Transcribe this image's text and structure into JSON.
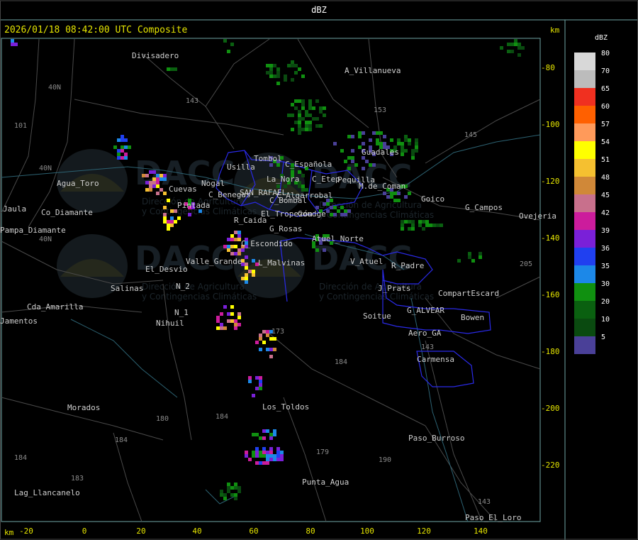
{
  "header": {
    "product": "dBZ",
    "timestamp": "2026/01/18 08:42:00 UTC Composite",
    "unit_top": "km",
    "unit_bottom": "km"
  },
  "axes": {
    "x_ticks": [
      "-20",
      "0",
      "20",
      "40",
      "60",
      "80",
      "100",
      "120",
      "140"
    ],
    "y_ticks": [
      "-80",
      "-100",
      "-120",
      "-140",
      "-160",
      "-180",
      "-200",
      "-220"
    ]
  },
  "legend": {
    "title": "dBZ",
    "levels": [
      {
        "label": "80",
        "color": "#d8d8d8"
      },
      {
        "label": "70",
        "color": "#bcbcbc"
      },
      {
        "label": "65",
        "color": "#f03020"
      },
      {
        "label": "60",
        "color": "#ff6000"
      },
      {
        "label": "57",
        "color": "#ff9a5a"
      },
      {
        "label": "54",
        "color": "#ffff00"
      },
      {
        "label": "51",
        "color": "#f5c030"
      },
      {
        "label": "48",
        "color": "#d08838"
      },
      {
        "label": "45",
        "color": "#c8708c"
      },
      {
        "label": "42",
        "color": "#cc1c9c"
      },
      {
        "label": "39",
        "color": "#7a20d8"
      },
      {
        "label": "36",
        "color": "#2040f0"
      },
      {
        "label": "35",
        "color": "#1c88e8"
      },
      {
        "label": "30",
        "color": "#109010"
      },
      {
        "label": "20",
        "color": "#0a6010"
      },
      {
        "label": "10",
        "color": "#0a4a10"
      },
      {
        "label": "5",
        "color": "#4a4098"
      }
    ]
  },
  "watermark": {
    "brand": "DACC",
    "line1": "Dirección de Agricultura",
    "line2": "y Contingencias Climáticas"
  },
  "places": [
    {
      "name": "Divisadero"
    },
    {
      "name": "A_Villanueva"
    },
    {
      "name": "Agua_Toro"
    },
    {
      "name": "Nogal"
    },
    {
      "name": "Cuevas"
    },
    {
      "name": "Usilla"
    },
    {
      "name": "Tombol"
    },
    {
      "name": "La_Nora"
    },
    {
      "name": "C_Española"
    },
    {
      "name": "C_Etep"
    },
    {
      "name": "Pequilla"
    },
    {
      "name": "M.de_Coman"
    },
    {
      "name": "Guadales"
    },
    {
      "name": "Goico"
    },
    {
      "name": "G_Campos"
    },
    {
      "name": "Ovejeria"
    },
    {
      "name": "C_Benegas"
    },
    {
      "name": "SAN_RAFAEL"
    },
    {
      "name": "C_Algarrobal"
    },
    {
      "name": "C_Bombal"
    },
    {
      "name": "Pintada"
    },
    {
      "name": "R_Caida"
    },
    {
      "name": "El_Tropezón"
    },
    {
      "name": "Goudge"
    },
    {
      "name": "G_Rosas"
    },
    {
      "name": "Atuel_Norte"
    },
    {
      "name": "Pampa_Diamante"
    },
    {
      "name": "Co_Diamante"
    },
    {
      "name": "El_Desvio"
    },
    {
      "name": "Valle_Grande"
    },
    {
      "name": "C_Escondido"
    },
    {
      "name": "L_Malvinas"
    },
    {
      "name": "V_Atuel"
    },
    {
      "name": "R_Padre"
    },
    {
      "name": "Salinas"
    },
    {
      "name": "N_2"
    },
    {
      "name": "N_1"
    },
    {
      "name": "Nihuil"
    },
    {
      "name": "J_Prats"
    },
    {
      "name": "CompartEscard"
    },
    {
      "name": "G_ALVEAR"
    },
    {
      "name": "Bowen"
    },
    {
      "name": "Soitue"
    },
    {
      "name": "Aero_GA"
    },
    {
      "name": "Carmensa"
    },
    {
      "name": "Cda_Amarilla"
    },
    {
      "name": "Jamentos"
    },
    {
      "name": "Morados"
    },
    {
      "name": "Los_Toldos"
    },
    {
      "name": "Paso_Burroso"
    },
    {
      "name": "Punta_Agua"
    },
    {
      "name": "Lag_Llancanelo"
    },
    {
      "name": "Paso_El_Loro"
    },
    {
      "name": "Jaula"
    }
  ],
  "routes": [
    "143",
    "153",
    "101",
    "40N",
    "40N",
    "40N",
    "145",
    "173",
    "184",
    "180",
    "184",
    "184",
    "183",
    "179",
    "190",
    "143",
    "143",
    "205",
    "184"
  ]
}
